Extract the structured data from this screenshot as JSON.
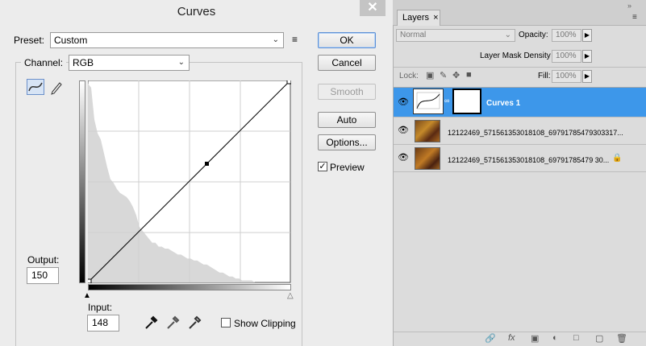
{
  "dialog": {
    "title": "Curves",
    "close_label": "✕",
    "preset_label": "Preset:",
    "preset_value": "Custom",
    "channel_label": "Channel:",
    "channel_value": "RGB",
    "buttons": {
      "ok": "OK",
      "cancel": "Cancel",
      "smooth": "Smooth",
      "auto": "Auto",
      "options": "Options..."
    },
    "preview_label": "Preview",
    "preview_checked": true,
    "output_label": "Output:",
    "output_value": "150",
    "input_label": "Input:",
    "input_value": "148",
    "show_clipping_label": "Show Clipping",
    "show_clipping_checked": false,
    "curve_point": {
      "input": 148,
      "output": 150
    },
    "histogram": [
      100,
      98,
      82,
      75,
      72,
      65,
      58,
      52,
      50,
      47,
      45,
      44,
      43,
      41,
      38,
      34,
      28,
      26,
      24,
      22,
      20,
      20,
      18,
      18,
      17,
      17,
      16,
      15,
      14,
      14,
      13,
      12,
      12,
      11,
      11,
      10,
      9,
      9,
      8,
      7,
      6,
      5,
      5,
      4,
      3,
      3,
      2,
      2,
      1,
      1,
      1,
      1,
      0,
      0,
      0,
      0,
      0,
      0,
      0,
      0,
      0,
      0,
      0,
      0
    ]
  },
  "layers_panel": {
    "tab_label": "Layers",
    "tab_close": "×",
    "blend_mode": "Normal",
    "opacity_label": "Opacity:",
    "opacity_value": "100%",
    "mask_density_label": "Layer Mask Density",
    "mask_density_value": "100%",
    "lock_label": "Lock:",
    "fill_label": "Fill:",
    "fill_value": "100%",
    "layers": [
      {
        "name": "Curves 1",
        "selected": true
      },
      {
        "name": "12122469_571561353018108_6979178547930331 7..."
      },
      {
        "name": "12122469_571561353018108_6979178547930..."
      }
    ],
    "layer_names": [
      "Curves 1",
      "12122469_571561353018108_69791785479303317...",
      "12122469_571561353018108_69791785479 30..."
    ]
  },
  "colors": {
    "accent": "#3d97ea",
    "selection_text": "#ffffff"
  }
}
